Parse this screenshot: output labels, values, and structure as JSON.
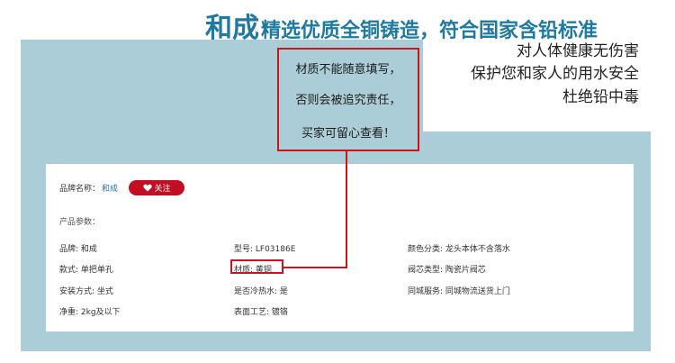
{
  "header": {
    "brand": "和成",
    "headline": "精选优质全铜铸造，符合国家含铅标准",
    "sub_lines": [
      "对人体健康无伤害",
      "保护您和家人的用水安全",
      "杜绝铅中毒"
    ]
  },
  "callout": {
    "lines": [
      "材质不能随意填写，",
      "否则会被追究责任，",
      "买家可留心查看！"
    ]
  },
  "card": {
    "brand_label": "品牌名称：",
    "brand_value": "和成",
    "follow_label": "关注",
    "params_title": "产品参数：",
    "params": {
      "col1": [
        "品牌: 和成",
        "款式: 单把单孔",
        "安装方式: 坐式",
        "净重: 2kg及以下"
      ],
      "col2": [
        "型号: LF03186E",
        "材质: 黄铜",
        "是否冷热水: 是",
        "表面工艺: 镀铬"
      ],
      "col3": [
        "颜色分类: 龙头本体不含落水",
        "阀芯类型: 陶瓷片阀芯",
        "同城服务: 同城物流送货上门"
      ]
    }
  },
  "colors": {
    "accent_blue": "#1e7aa0",
    "band": "#abcdd8",
    "callout_red": "#c9151e",
    "follow_red": "#c30d23"
  },
  "icons": {
    "follow": "heart-icon"
  }
}
